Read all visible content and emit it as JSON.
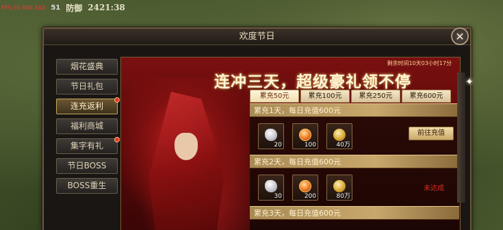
{
  "hud": {
    "fps": "FPS:30 MIN:XXX",
    "value": "51",
    "defense_label": "防御",
    "defense_value": "2421:38"
  },
  "dialog": {
    "title": "欢度节日",
    "close_glyph": "✕"
  },
  "sidebar": {
    "items": [
      {
        "label": "烟花盛典"
      },
      {
        "label": "节日礼包"
      },
      {
        "label": "连充返利"
      },
      {
        "label": "福利商城"
      },
      {
        "label": "集字有礼"
      },
      {
        "label": "节日BOSS"
      },
      {
        "label": "BOSS重生"
      }
    ],
    "active_index": 2
  },
  "banner": {
    "title": "连冲三天，超级豪礼领不停",
    "countdown": "剩余时间10天03小时17分"
  },
  "tabs": [
    "累充50元",
    "累充100元",
    "累充250元",
    "累充600元"
  ],
  "rows": [
    {
      "header": "累充1天，每日充值600元",
      "items": [
        {
          "icon": "white-gem-icon",
          "qty": "20"
        },
        {
          "icon": "orange-orb-icon",
          "qty": "100"
        },
        {
          "icon": "gold-coin-icon",
          "qty": "40万"
        }
      ],
      "action_label": "前往充值"
    },
    {
      "header": "累充2天，每日充值600元",
      "items": [
        {
          "icon": "white-gem-icon",
          "qty": "30"
        },
        {
          "icon": "orange-orb-icon",
          "qty": "200"
        },
        {
          "icon": "gold-coin-icon",
          "qty": "80万"
        }
      ],
      "status_label": "未达成"
    },
    {
      "header": "累充3天，每日充值600元"
    }
  ],
  "colors": {
    "accent_gold": "#c8a860",
    "banner_red": "#7a1010",
    "status_red": "#e02a20"
  }
}
